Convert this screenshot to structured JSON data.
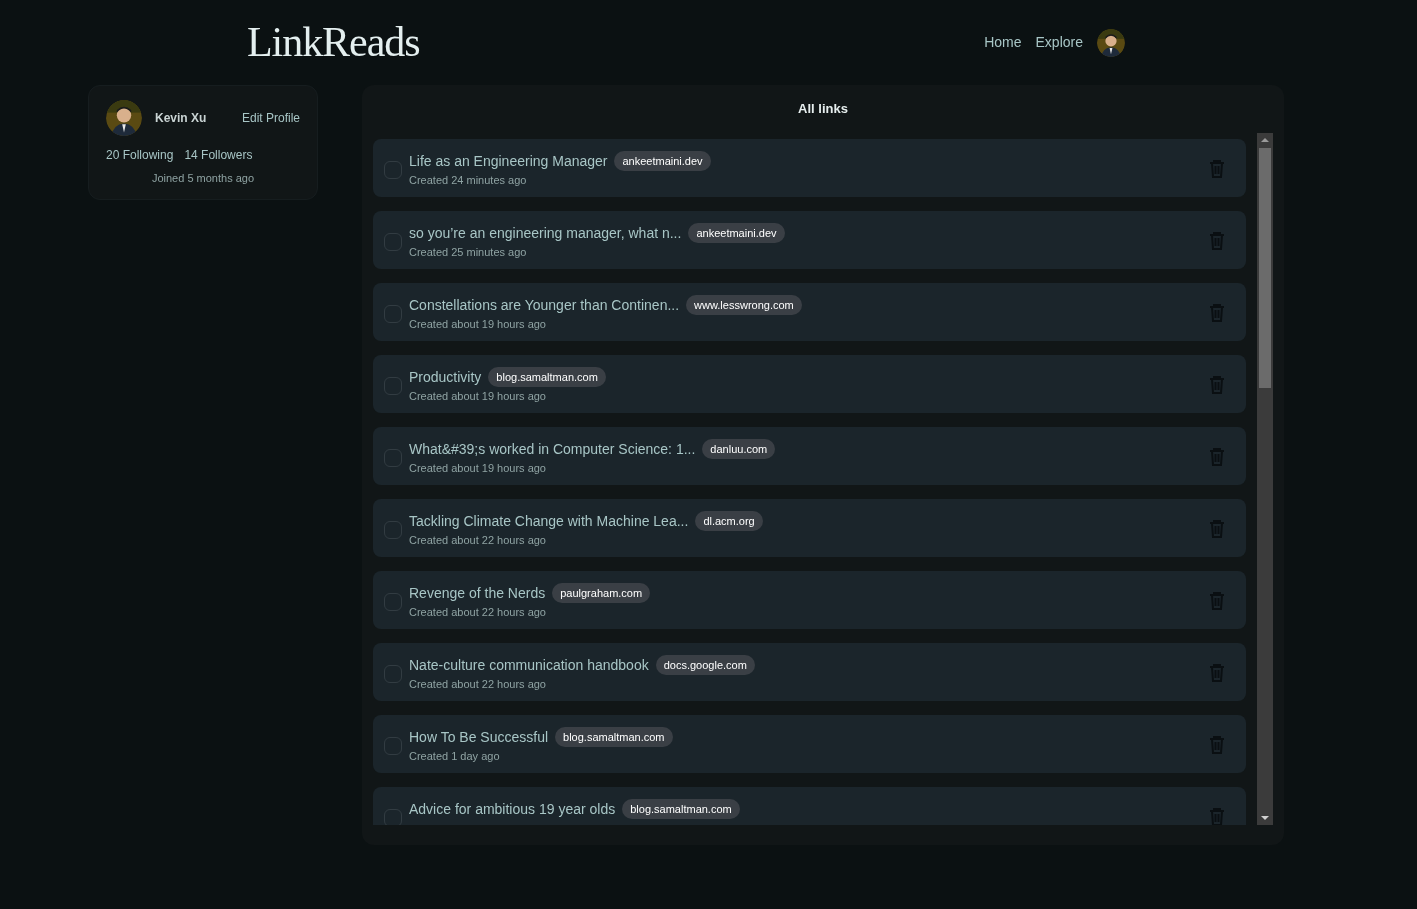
{
  "header": {
    "logo": "LinkReads",
    "nav": [
      {
        "label": "Home"
      },
      {
        "label": "Explore"
      }
    ]
  },
  "profile": {
    "name": "Kevin Xu",
    "edit": "Edit Profile",
    "following": "20 Following",
    "followers": "14 Followers",
    "joined": "Joined 5 months ago"
  },
  "links_panel": {
    "title": "All links",
    "items": [
      {
        "title": "Life as an Engineering Manager",
        "domain": "ankeetmaini.dev",
        "created": "Created 24 minutes ago",
        "checked": false
      },
      {
        "title": "so you’re an engineering manager, what n...",
        "domain": "ankeetmaini.dev",
        "created": "Created 25 minutes ago",
        "checked": false
      },
      {
        "title": "Constellations are Younger than Continen...",
        "domain": "www.lesswrong.com",
        "created": "Created about 19 hours ago",
        "checked": false
      },
      {
        "title": "Productivity",
        "domain": "blog.samaltman.com",
        "created": "Created about 19 hours ago",
        "checked": false
      },
      {
        "title": "What&#39;s worked in Computer Science: 1...",
        "domain": "danluu.com",
        "created": "Created about 19 hours ago",
        "checked": false
      },
      {
        "title": "Tackling Climate Change with Machine Lea...",
        "domain": "dl.acm.org",
        "created": "Created about 22 hours ago",
        "checked": false
      },
      {
        "title": "Revenge of the Nerds",
        "domain": "paulgraham.com",
        "created": "Created about 22 hours ago",
        "checked": false
      },
      {
        "title": "Nate-culture communication handbook",
        "domain": "docs.google.com",
        "created": "Created about 22 hours ago",
        "checked": false
      },
      {
        "title": "How To Be Successful",
        "domain": "blog.samaltman.com",
        "created": "Created 1 day ago",
        "checked": false
      },
      {
        "title": "Advice for ambitious 19 year olds",
        "domain": "blog.samaltman.com",
        "checked": false
      }
    ]
  }
}
